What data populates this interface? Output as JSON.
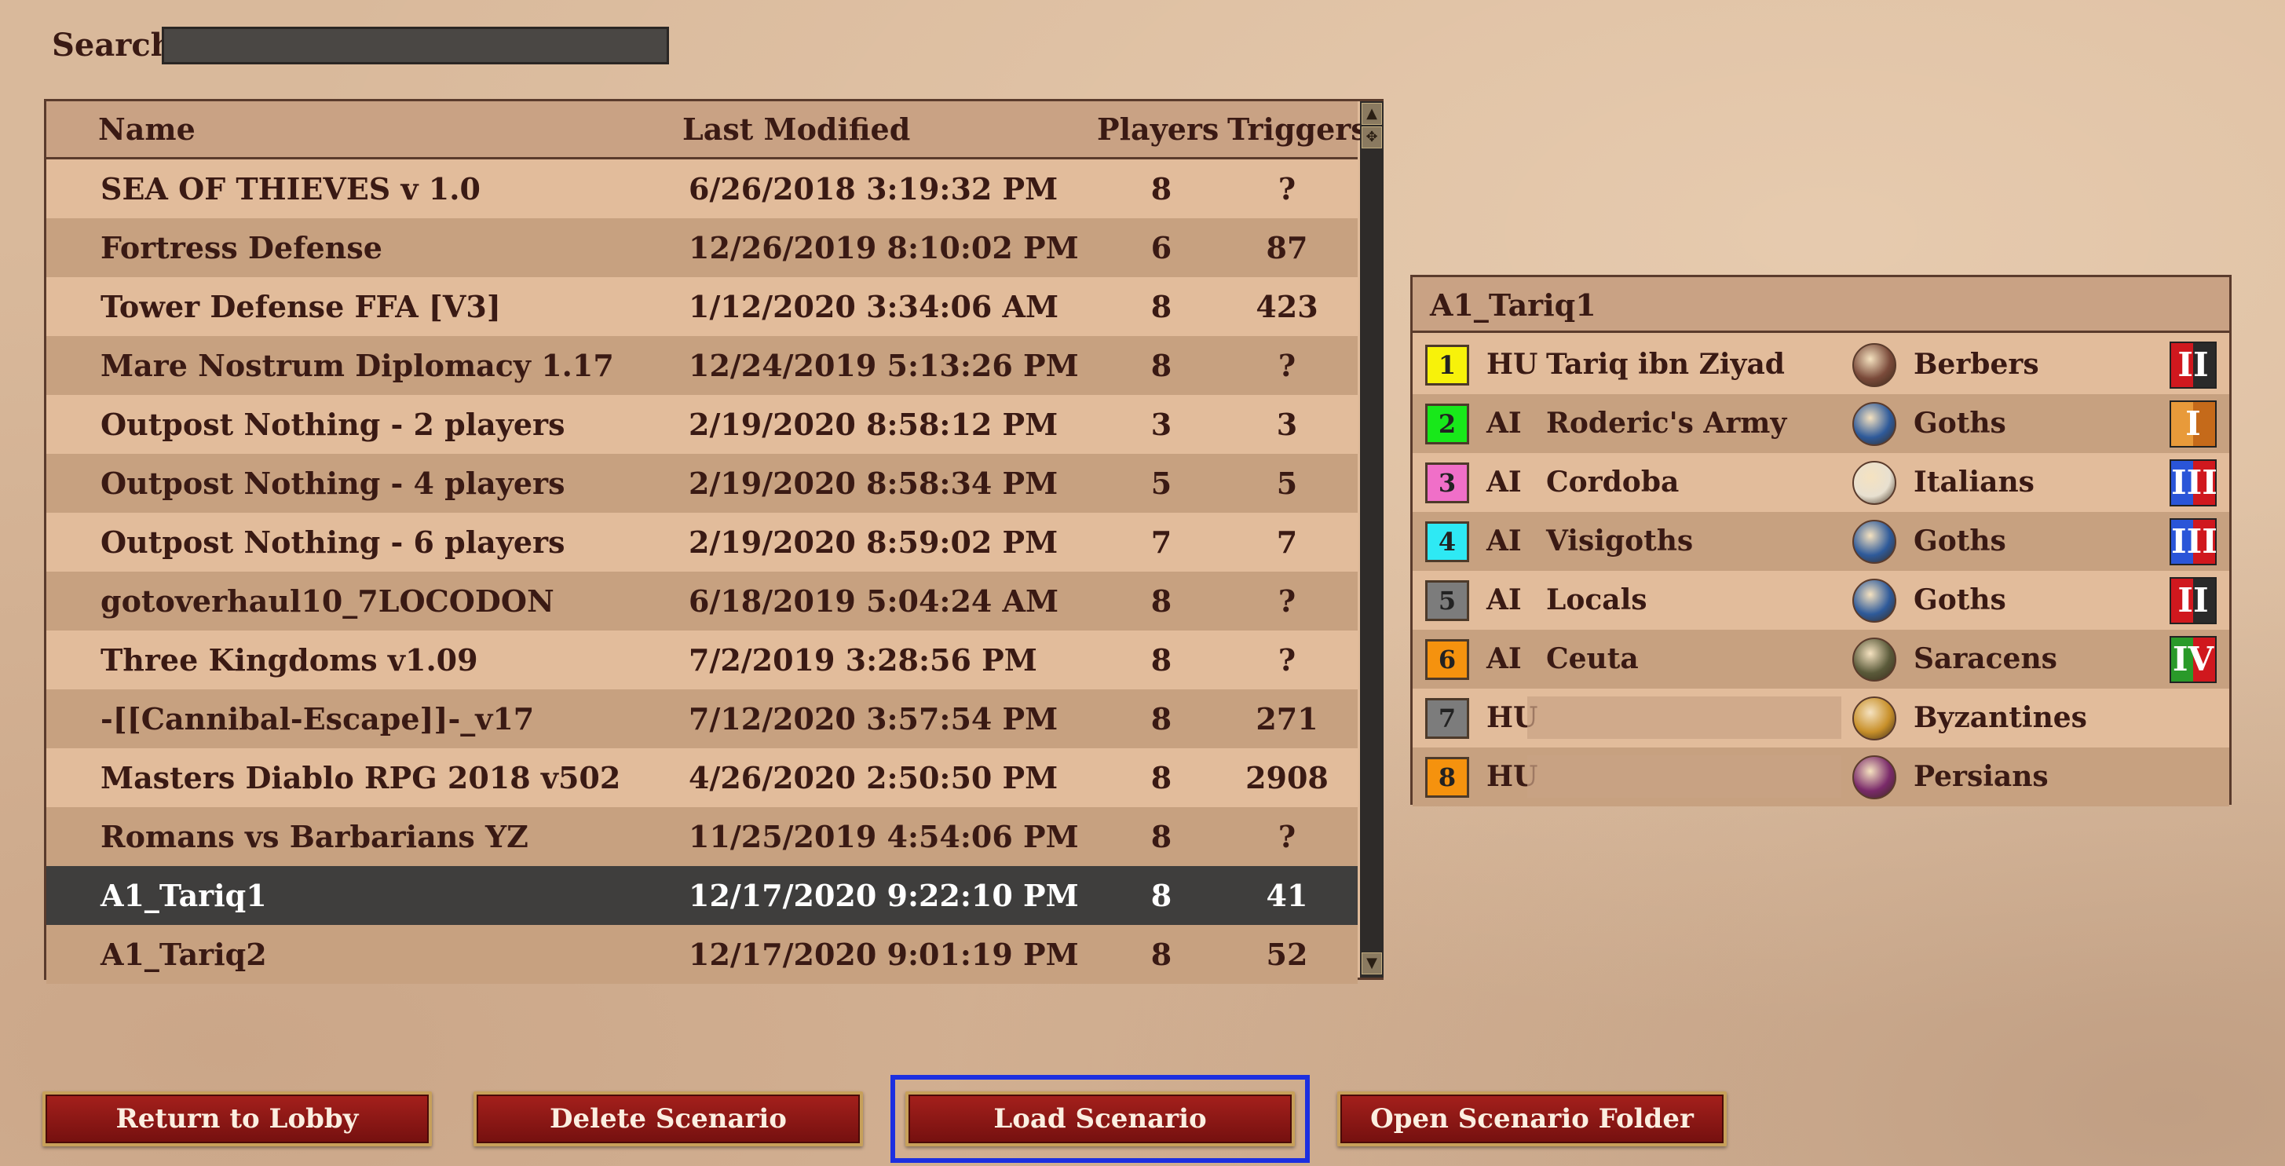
{
  "search": {
    "label": "Search",
    "value": "",
    "placeholder": ""
  },
  "list": {
    "columns": {
      "name": "Name",
      "modified": "Last Modified",
      "players": "Players",
      "triggers": "Triggers"
    },
    "rows": [
      {
        "name": "SEA OF THIEVES v 1.0",
        "modified": "6/26/2018 3:19:32 PM",
        "players": "8",
        "triggers": "?"
      },
      {
        "name": "Fortress Defense",
        "modified": "12/26/2019 8:10:02 PM",
        "players": "6",
        "triggers": "87"
      },
      {
        "name": "Tower Defense FFA [V3]",
        "modified": "1/12/2020 3:34:06 AM",
        "players": "8",
        "triggers": "423"
      },
      {
        "name": "Mare Nostrum Diplomacy 1.17",
        "modified": "12/24/2019 5:13:26 PM",
        "players": "8",
        "triggers": "?"
      },
      {
        "name": "Outpost Nothing - 2 players",
        "modified": "2/19/2020 8:58:12 PM",
        "players": "3",
        "triggers": "3"
      },
      {
        "name": "Outpost Nothing - 4 players",
        "modified": "2/19/2020 8:58:34 PM",
        "players": "5",
        "triggers": "5"
      },
      {
        "name": "Outpost Nothing - 6 players",
        "modified": "2/19/2020 8:59:02 PM",
        "players": "7",
        "triggers": "7"
      },
      {
        "name": "gotoverhaul10_7LOCODON",
        "modified": "6/18/2019 5:04:24 AM",
        "players": "8",
        "triggers": "?"
      },
      {
        "name": "Three Kingdoms v1.09",
        "modified": "7/2/2019 3:28:56 PM",
        "players": "8",
        "triggers": "?"
      },
      {
        "name": "-[[Cannibal-Escape]]-_v17",
        "modified": "7/12/2020 3:57:54 PM",
        "players": "8",
        "triggers": "271"
      },
      {
        "name": "Masters Diablo RPG 2018 v502",
        "modified": "4/26/2020 2:50:50 PM",
        "players": "8",
        "triggers": "2908"
      },
      {
        "name": "Romans vs Barbarians YZ",
        "modified": "11/25/2019 4:54:06 PM",
        "players": "8",
        "triggers": "?"
      },
      {
        "name": "A1_Tariq1",
        "modified": "12/17/2020 9:22:10 PM",
        "players": "8",
        "triggers": "41",
        "selected": true
      },
      {
        "name": "A1_Tariq2",
        "modified": "12/17/2020 9:01:19 PM",
        "players": "8",
        "triggers": "52"
      }
    ]
  },
  "details": {
    "title": "A1_Tariq1",
    "players": [
      {
        "num": "1",
        "color": "#f7f20a",
        "type": "HU",
        "name": "Tariq ibn Ziyad",
        "civ": "Berbers",
        "civ_icon": "berbers-emblem-icon",
        "civ_color": "#7a4a3a",
        "age": "II",
        "age_colors": [
          "#d0181e",
          "#2a2a2a"
        ]
      },
      {
        "num": "2",
        "color": "#18e81a",
        "type": "AI",
        "name": "Roderic's Army",
        "civ": "Goths",
        "civ_icon": "goths-emblem-icon",
        "civ_color": "#2e5a9a",
        "age": "I",
        "age_colors": [
          "#e89a3a",
          "#c56a1a"
        ]
      },
      {
        "num": "3",
        "color": "#f06fc8",
        "type": "AI",
        "name": "Cordoba",
        "civ": "Italians",
        "civ_icon": "italians-emblem-icon",
        "civ_color": "#e8e0d0",
        "age": "III",
        "age_colors": [
          "#2a55d8",
          "#d0181e"
        ]
      },
      {
        "num": "4",
        "color": "#2ee9f4",
        "type": "AI",
        "name": "Visigoths",
        "civ": "Goths",
        "civ_icon": "goths-emblem-icon",
        "civ_color": "#2e5a9a",
        "age": "III",
        "age_colors": [
          "#2a55d8",
          "#d0181e"
        ]
      },
      {
        "num": "5",
        "color": "#7c7c7c",
        "type": "AI",
        "name": "Locals",
        "civ": "Goths",
        "civ_icon": "goths-emblem-icon",
        "civ_color": "#2e5a9a",
        "age": "II",
        "age_colors": [
          "#d0181e",
          "#2a2a2a"
        ]
      },
      {
        "num": "6",
        "color": "#f5920e",
        "type": "AI",
        "name": "Ceuta",
        "civ": "Saracens",
        "civ_icon": "saracens-emblem-icon",
        "civ_color": "#5a5a3a",
        "age": "IV",
        "age_colors": [
          "#2a9a2a",
          "#d0181e"
        ]
      },
      {
        "num": "7",
        "color": "#7c7c7c",
        "type": "HU",
        "name": "",
        "civ": "Byzantines",
        "civ_icon": "byzantines-emblem-icon",
        "civ_color": "#c8902a",
        "age": "",
        "age_colors": []
      },
      {
        "num": "8",
        "color": "#f5920e",
        "type": "HU",
        "name": "",
        "civ": "Persians",
        "civ_icon": "persians-emblem-icon",
        "civ_color": "#7a2a6a",
        "age": "",
        "age_colors": []
      }
    ]
  },
  "buttons": {
    "return_lobby": "Return to Lobby",
    "delete_scenario": "Delete Scenario",
    "load_scenario": "Load Scenario",
    "open_folder": "Open Scenario Folder"
  },
  "colors": {
    "focus_ring": "#1c2fe0",
    "button_red": "#8a1414",
    "selected_row": "#3f3e3d"
  }
}
